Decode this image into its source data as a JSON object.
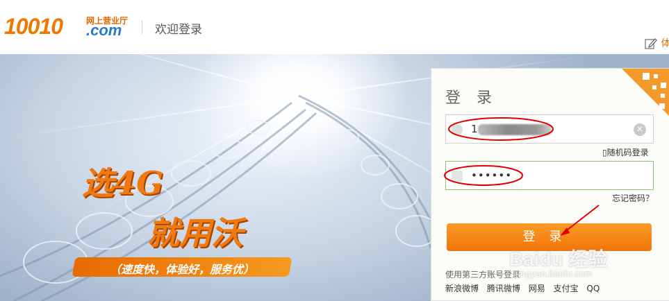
{
  "header": {
    "logo_number": "10010",
    "logo_cn": "网上营业厅",
    "logo_com": ".com",
    "welcome": "欢迎登录",
    "feedback_label": "体",
    "feedback_icon": "edit-icon"
  },
  "banner": {
    "slogan_line1": "选4G",
    "slogan_line2": "就用沃",
    "slogan_sub": "（速度快，体验好，服务优）"
  },
  "login": {
    "title": "登 录",
    "username_value": "1",
    "password_value": "••••••",
    "random_code_link": "随机码登录",
    "forgot_password": "忘记密码？",
    "submit_label": "登录",
    "third_party_title": "使用第三方账号登录",
    "third_party": [
      "新浪微博",
      "腾讯微博",
      "网易",
      "支付宝",
      "QQ"
    ]
  },
  "watermark": {
    "text": "Baidu 经验",
    "sub": "jingyan.baidu.com"
  },
  "colors": {
    "accent": "#f07800",
    "brand_blue": "#2a78c8",
    "annotation_red": "#e00000"
  }
}
